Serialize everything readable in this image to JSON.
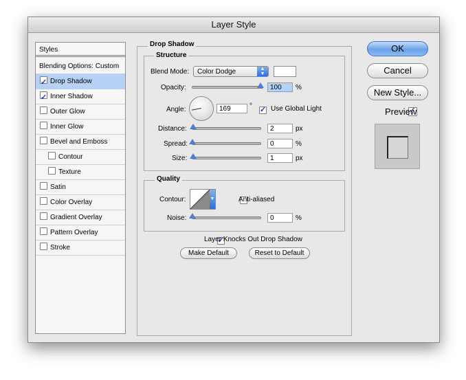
{
  "window": {
    "title": "Layer Style"
  },
  "styles": {
    "header": "Styles",
    "blending": "Blending Options: Custom",
    "items": [
      {
        "label": "Drop Shadow",
        "checked": true,
        "selected": true
      },
      {
        "label": "Inner Shadow",
        "checked": true
      },
      {
        "label": "Outer Glow",
        "checked": false
      },
      {
        "label": "Inner Glow",
        "checked": false
      },
      {
        "label": "Bevel and Emboss",
        "checked": false
      },
      {
        "label": "Contour",
        "checked": false
      },
      {
        "label": "Texture",
        "checked": false
      },
      {
        "label": "Satin",
        "checked": false
      },
      {
        "label": "Color Overlay",
        "checked": false
      },
      {
        "label": "Gradient Overlay",
        "checked": false
      },
      {
        "label": "Pattern Overlay",
        "checked": false
      },
      {
        "label": "Stroke",
        "checked": false
      }
    ]
  },
  "drop_shadow": {
    "title": "Drop Shadow",
    "structure": {
      "title": "Structure",
      "blend_mode_label": "Blend Mode:",
      "blend_mode_value": "Color Dodge",
      "shadow_color": "#ffffff",
      "opacity_label": "Opacity:",
      "opacity_value": "100",
      "opacity_unit": "%",
      "opacity_level": 1.0,
      "angle_label": "Angle:",
      "angle_value": "169",
      "angle_unit": "°",
      "use_global_light_label": "Use Global Light",
      "use_global_light": true,
      "distance_label": "Distance:",
      "distance_value": "2",
      "distance_unit": "px",
      "spread_label": "Spread:",
      "spread_value": "0",
      "spread_unit": "%",
      "size_label": "Size:",
      "size_value": "1",
      "size_unit": "px"
    },
    "quality": {
      "title": "Quality",
      "contour_label": "Contour:",
      "anti_aliased_label": "Anti-aliased",
      "anti_aliased": false,
      "noise_label": "Noise:",
      "noise_value": "0",
      "noise_unit": "%"
    },
    "knocks_out_label": "Layer Knocks Out Drop Shadow",
    "knocks_out": true,
    "make_default": "Make Default",
    "reset_default": "Reset to Default"
  },
  "buttons": {
    "ok": "OK",
    "cancel": "Cancel",
    "new_style": "New Style...",
    "preview_label": "Preview",
    "preview": true
  },
  "colors": {
    "accent": "#4d7fd6",
    "selection": "#b5d1f5"
  }
}
